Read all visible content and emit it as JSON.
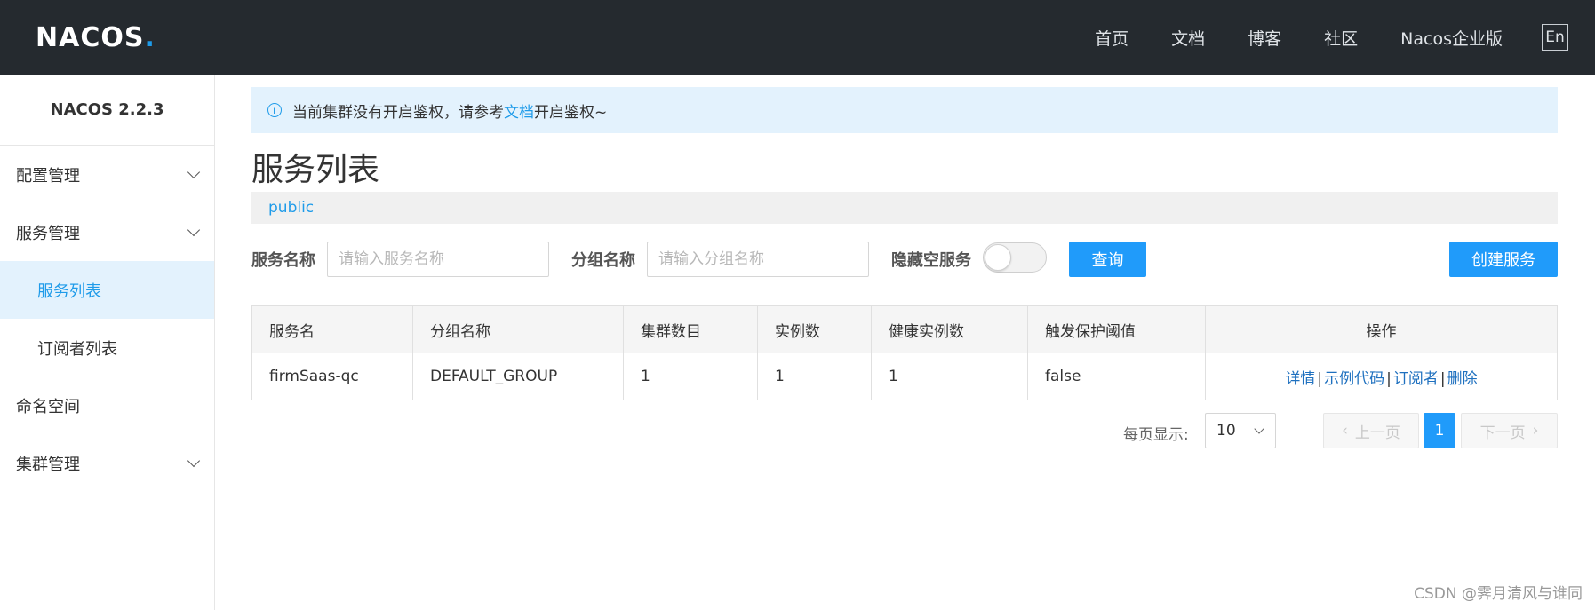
{
  "header": {
    "logo": "NACOS",
    "nav": [
      "首页",
      "文档",
      "博客",
      "社区",
      "Nacos企业版"
    ],
    "lang": "En"
  },
  "sidebar": {
    "version": "NACOS 2.2.3",
    "items": [
      {
        "label": "配置管理"
      },
      {
        "label": "服务管理"
      },
      {
        "label": "服务列表"
      },
      {
        "label": "订阅者列表"
      },
      {
        "label": "命名空间"
      },
      {
        "label": "集群管理"
      }
    ]
  },
  "alert": {
    "text_before": "当前集群没有开启鉴权，请参考",
    "link": "文档",
    "text_after": "开启鉴权~"
  },
  "page": {
    "title": "服务列表",
    "namespace": "public"
  },
  "search": {
    "service_name_label": "服务名称",
    "service_name_placeholder": "请输入服务名称",
    "group_name_label": "分组名称",
    "group_name_placeholder": "请输入分组名称",
    "hide_empty_label": "隐藏空服务",
    "query_button": "查询",
    "create_button": "创建服务"
  },
  "table": {
    "headers": [
      "服务名",
      "分组名称",
      "集群数目",
      "实例数",
      "健康实例数",
      "触发保护阈值",
      "操作"
    ],
    "rows": [
      {
        "service": "firmSaas-qc",
        "group": "DEFAULT_GROUP",
        "clusters": "1",
        "instances": "1",
        "healthy": "1",
        "threshold": "false",
        "ops": [
          "详情",
          "示例代码",
          "订阅者",
          "删除"
        ]
      }
    ]
  },
  "pager": {
    "label": "每页显示:",
    "size": "10",
    "prev": "上一页",
    "current": "1",
    "next": "下一页"
  },
  "watermark": "CSDN @霁月清风与谁同"
}
